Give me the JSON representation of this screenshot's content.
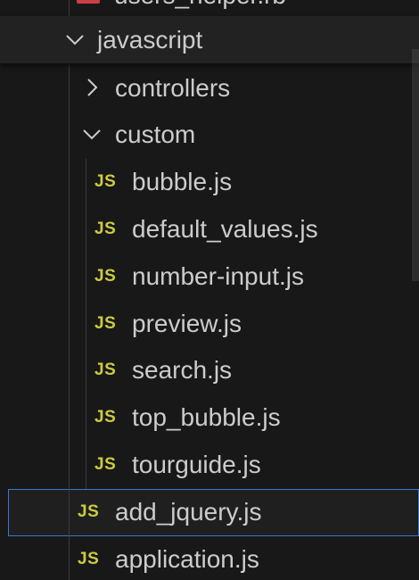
{
  "explorer": {
    "partial_file": {
      "label": "users_helper.rb",
      "icon": "ruby-icon"
    },
    "folders": {
      "javascript": {
        "label": "javascript",
        "expanded": true
      },
      "controllers": {
        "label": "controllers",
        "expanded": false
      },
      "custom": {
        "label": "custom",
        "expanded": true
      }
    },
    "custom_files": [
      {
        "label": "bubble.js",
        "icon_text": "JS"
      },
      {
        "label": "default_values.js",
        "icon_text": "JS"
      },
      {
        "label": "number-input.js",
        "icon_text": "JS"
      },
      {
        "label": "preview.js",
        "icon_text": "JS"
      },
      {
        "label": "search.js",
        "icon_text": "JS"
      },
      {
        "label": "top_bubble.js",
        "icon_text": "JS"
      },
      {
        "label": "tourguide.js",
        "icon_text": "JS"
      }
    ],
    "javascript_files": [
      {
        "label": "add_jquery.js",
        "icon_text": "JS",
        "selected": true
      },
      {
        "label": "application.js",
        "icon_text": "JS",
        "selected": false
      }
    ],
    "colors": {
      "background": "#181818",
      "text": "#cccccc",
      "js_icon": "#cbcb41",
      "ruby_icon": "#cc3e44",
      "selection_border": "#3a78c9",
      "indent_guide": "#3c3c3c"
    }
  }
}
